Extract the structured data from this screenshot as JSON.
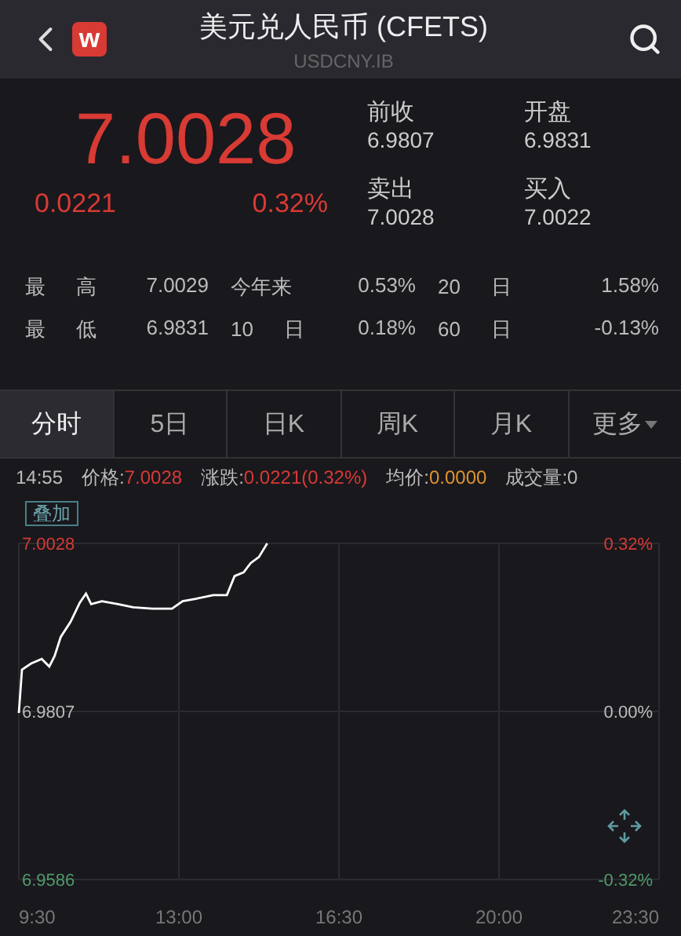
{
  "header": {
    "logo_text": "w",
    "title": "美元兑人民币 (CFETS)",
    "subtitle": "USDCNY.IB"
  },
  "quote": {
    "price": "7.0028",
    "change": "0.0221",
    "change_pct": "0.32%",
    "fields": [
      {
        "label": "前收",
        "value": "6.9807"
      },
      {
        "label": "开盘",
        "value": "6.9831"
      },
      {
        "label": "卖出",
        "value": "7.0028"
      },
      {
        "label": "买入",
        "value": "7.0022"
      }
    ]
  },
  "stats": [
    [
      {
        "label": "最 高",
        "value": "7.0029"
      },
      {
        "label": "今年来",
        "value": "0.53%"
      },
      {
        "label": "20 日",
        "value": "1.58%"
      }
    ],
    [
      {
        "label": "最 低",
        "value": "6.9831"
      },
      {
        "label": "10 日",
        "value": "0.18%"
      },
      {
        "label": "60 日",
        "value": "-0.13%"
      }
    ]
  ],
  "tabs": [
    {
      "label": "分时",
      "selected": true,
      "dropdown": false
    },
    {
      "label": "5日",
      "selected": false,
      "dropdown": false
    },
    {
      "label": "日K",
      "selected": false,
      "dropdown": false
    },
    {
      "label": "周K",
      "selected": false,
      "dropdown": false
    },
    {
      "label": "月K",
      "selected": false,
      "dropdown": false
    },
    {
      "label": "更多",
      "selected": false,
      "dropdown": true
    }
  ],
  "info": {
    "time": "14:55",
    "items": [
      {
        "label": "价格:",
        "value": "7.0028",
        "color": "#d83a34"
      },
      {
        "label": "涨跌:",
        "value": "0.0221(0.32%)",
        "color": "#d83a34"
      },
      {
        "label": "均价:",
        "value": "0.0000",
        "color": "#e0952f"
      },
      {
        "label": "成交量:",
        "value": "0",
        "color": "#bbbbbb"
      }
    ]
  },
  "chart": {
    "overlay_button": "叠加",
    "right_labels": [
      {
        "text": "0.32%",
        "color": "#d83a34"
      },
      {
        "text": "0.00%",
        "color": "#bbbbbb"
      },
      {
        "text": "-0.32%",
        "color": "#4f9a6a"
      }
    ],
    "chart_data": {
      "type": "line",
      "grid": true,
      "xlim": [
        9.5,
        23.5
      ],
      "ylim": [
        6.9586,
        7.0028
      ],
      "xticks": [
        {
          "value": 9.5,
          "label": "9:30"
        },
        {
          "value": 13,
          "label": "13:00"
        },
        {
          "value": 16.5,
          "label": "16:30"
        },
        {
          "value": 20,
          "label": "20:00"
        },
        {
          "value": 23.5,
          "label": "23:30"
        }
      ],
      "yticks": [
        {
          "value": 7.0028,
          "label": "7.0028"
        },
        {
          "value": 6.9807,
          "label": "6.9807"
        },
        {
          "value": 6.9586,
          "label": "6.9586"
        }
      ],
      "x": [
        9.5,
        9.567,
        9.767,
        10,
        10.167,
        10.283,
        10.417,
        10.633,
        10.833,
        10.967,
        11.083,
        11.317,
        11.667,
        12,
        12.417,
        12.85,
        13.083,
        13.367,
        13.75,
        14.05,
        14.217,
        14.417,
        14.567,
        14.75,
        14.933
      ],
      "series": [
        {
          "color": "#ffffff",
          "values": [
            6.9805,
            6.9862,
            6.987,
            6.9876,
            6.9866,
            6.988,
            6.9905,
            6.9925,
            6.995,
            6.9962,
            6.9948,
            6.9952,
            6.9948,
            6.9944,
            6.9942,
            6.9942,
            6.9952,
            6.9955,
            6.996,
            6.996,
            6.9985,
            6.999,
            7.0002,
            7.001,
            7.0028
          ]
        }
      ]
    }
  }
}
